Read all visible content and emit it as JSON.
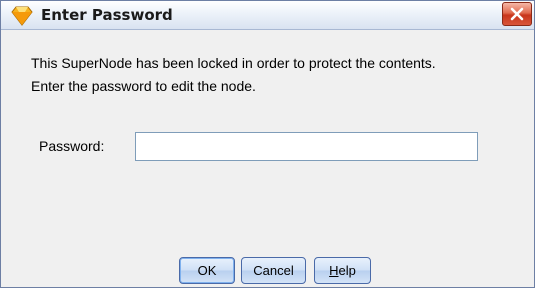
{
  "window": {
    "title": "Enter Password",
    "icon": "diamond-icon",
    "close": "close-icon"
  },
  "message": {
    "line1": "This SuperNode has been locked in order to protect the contents.",
    "line2": "Enter the password to edit the node."
  },
  "password": {
    "label": "Password:",
    "value": "",
    "placeholder": ""
  },
  "buttons": {
    "ok": "OK",
    "cancel": "Cancel",
    "help_mnemonic": "H",
    "help_rest": "elp"
  },
  "colors": {
    "accent": "#f2a81d",
    "close": "#d9533a",
    "button_border": "#4a6aa8"
  }
}
